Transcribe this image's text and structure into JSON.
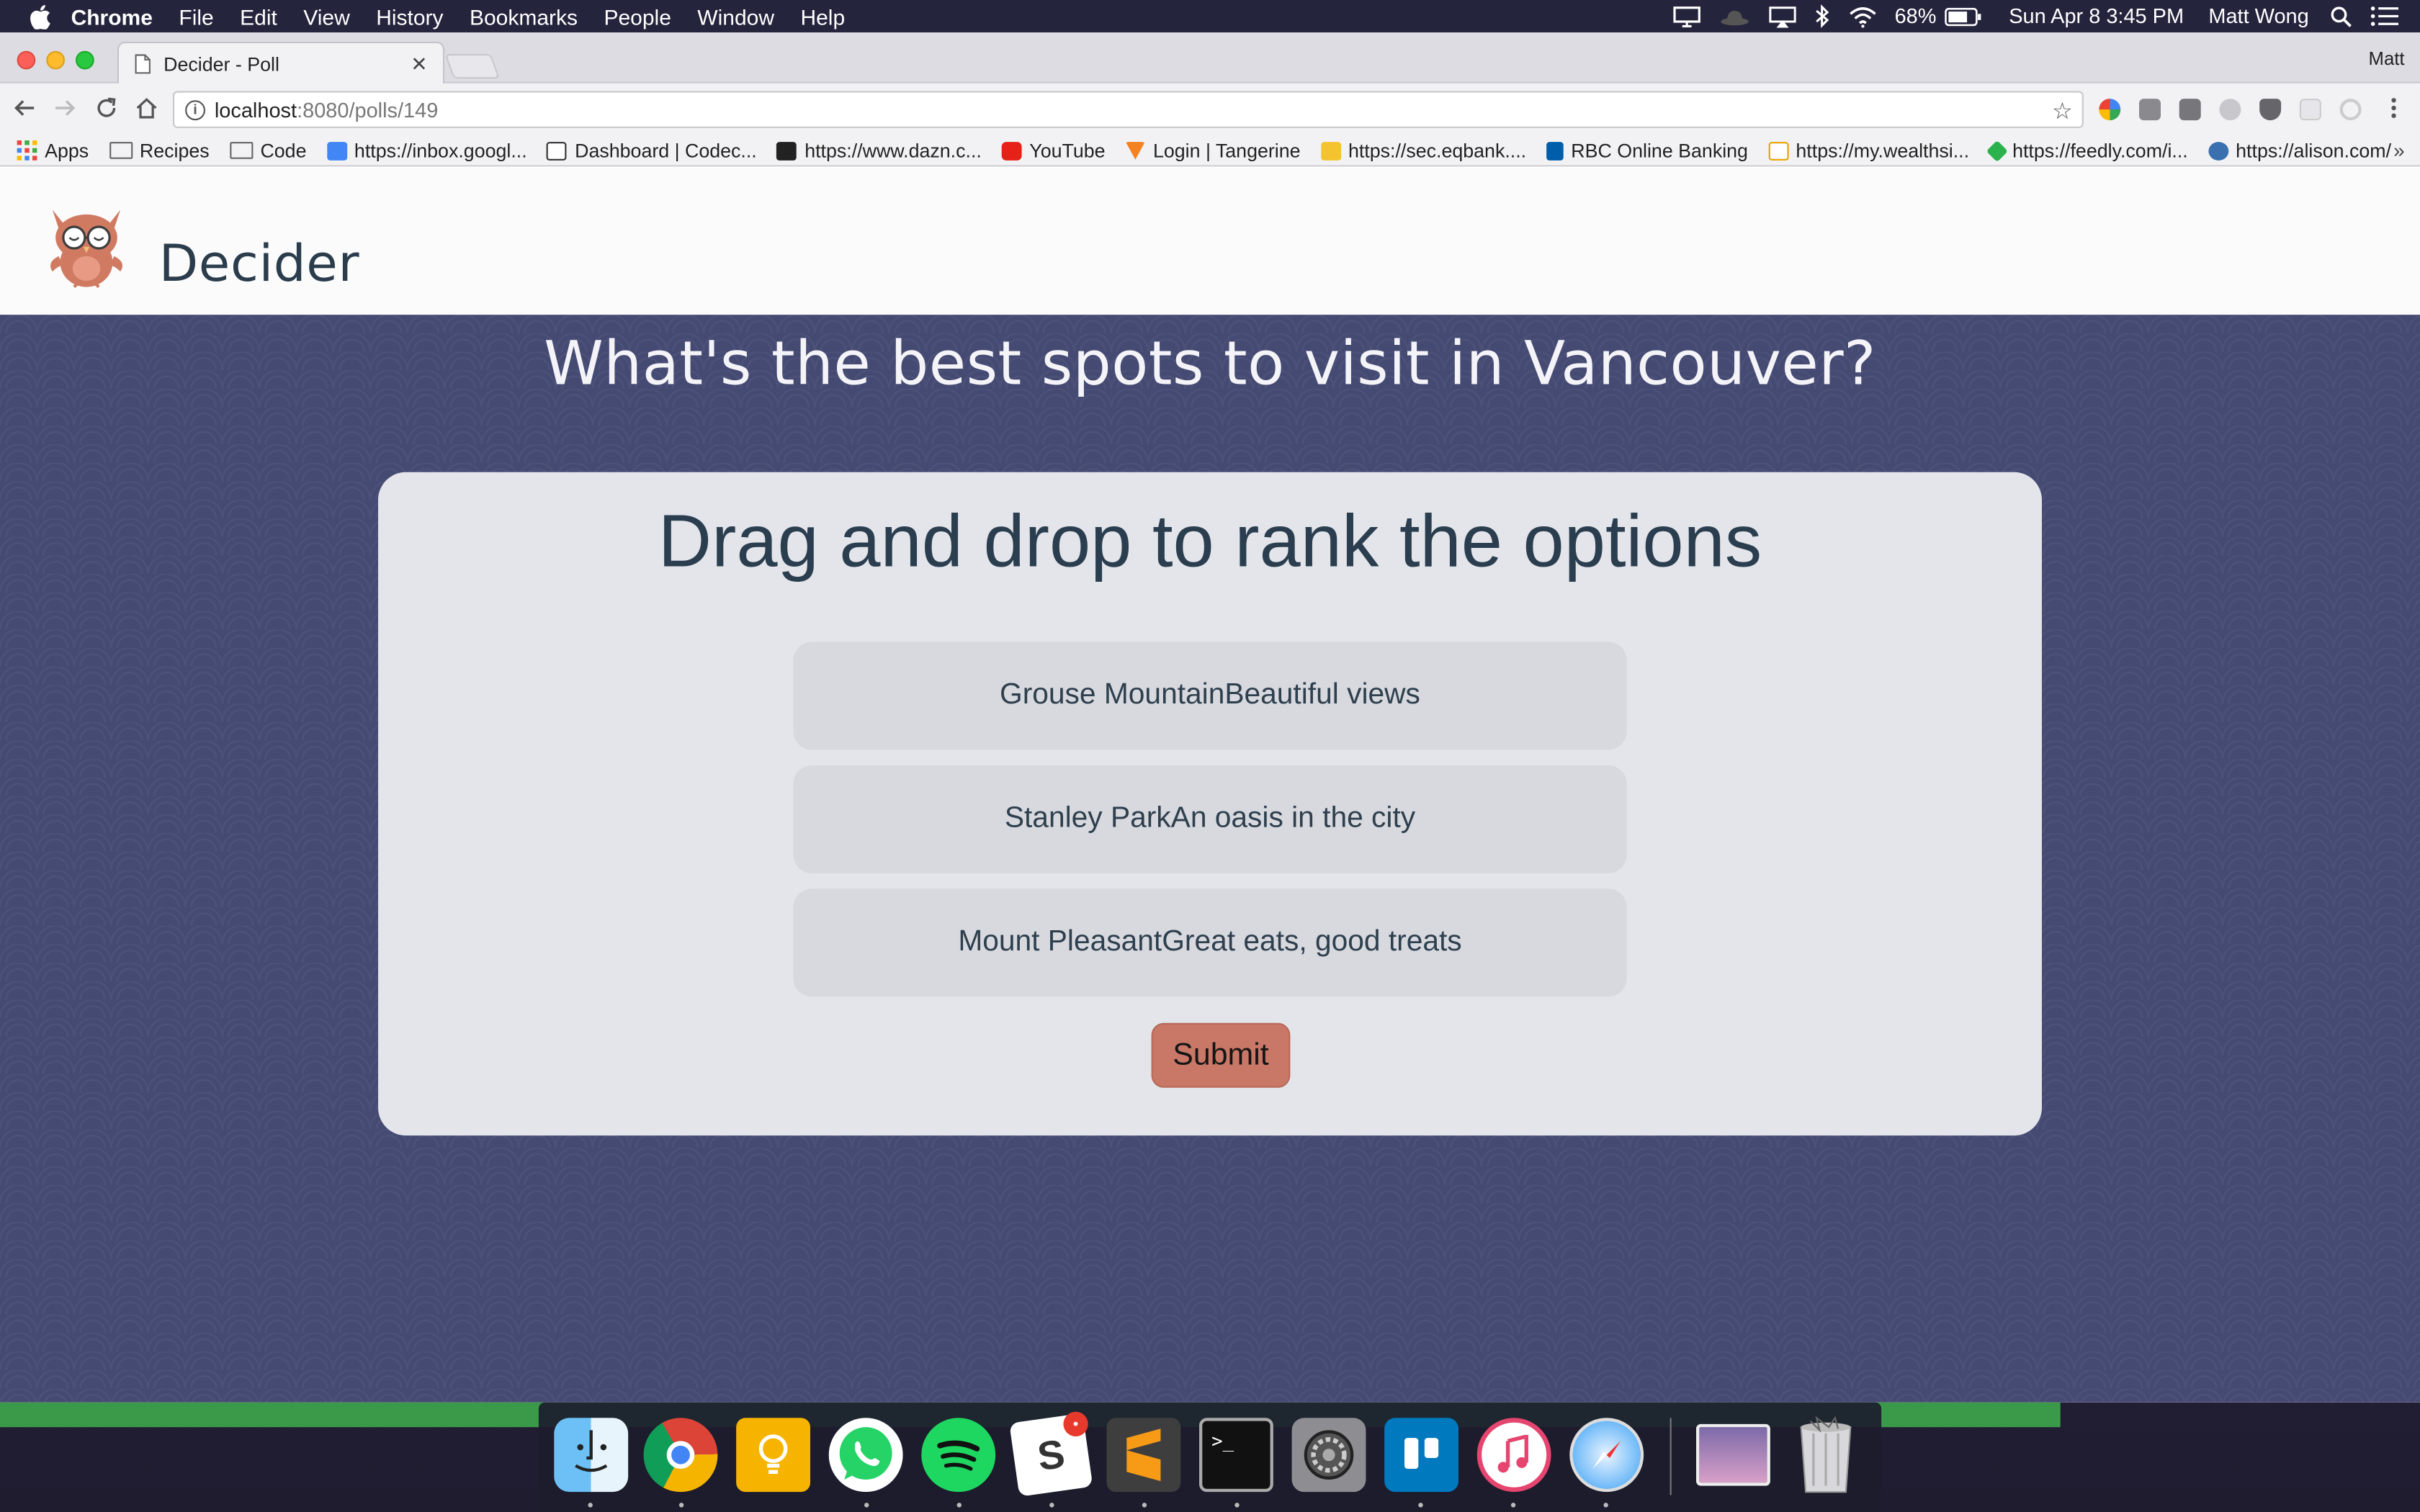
{
  "menubar": {
    "app_name": "Chrome",
    "items": [
      "File",
      "Edit",
      "View",
      "History",
      "Bookmarks",
      "People",
      "Window",
      "Help"
    ],
    "battery": "68%",
    "datetime": "Sun Apr 8  3:45 PM",
    "user": "Matt Wong"
  },
  "browser": {
    "tab_title": "Decider - Poll",
    "profile_name": "Matt",
    "url_host": "localhost",
    "url_path": ":8080/polls/149",
    "bookmarks": [
      "Apps",
      "Recipes",
      "Code",
      "https://inbox.googl...",
      "Dashboard | Codec...",
      "https://www.dazn.c...",
      "YouTube",
      "Login | Tangerine",
      "https://sec.eqbank....",
      "RBC Online Banking",
      "https://my.wealthsi...",
      "https://feedly.com/i...",
      "https://alison.com/"
    ]
  },
  "app": {
    "brand": "Decider",
    "question": "What's the best spots to visit in Vancouver?",
    "instruction": "Drag and drop to rank the options",
    "options": [
      "Grouse MountainBeautiful views",
      "Stanley ParkAn oasis in the city",
      "Mount PleasantGreat eats, good treats"
    ],
    "submit_label": "Submit",
    "colors": {
      "accent": "#c97766",
      "hero_bg": "#454a73",
      "card_bg": "#e3e5ea",
      "text_dark": "#2b3e4f"
    }
  },
  "dock": {
    "apps": [
      "finder-icon",
      "chrome-icon",
      "keep-icon",
      "whatsapp-icon",
      "spotify-icon",
      "slack-icon",
      "sublime-icon",
      "terminal-icon",
      "system-preferences-icon",
      "trello-icon",
      "itunes-icon",
      "safari-icon",
      "downloads-stack-icon",
      "trash-icon"
    ],
    "slack_badge": "•"
  }
}
